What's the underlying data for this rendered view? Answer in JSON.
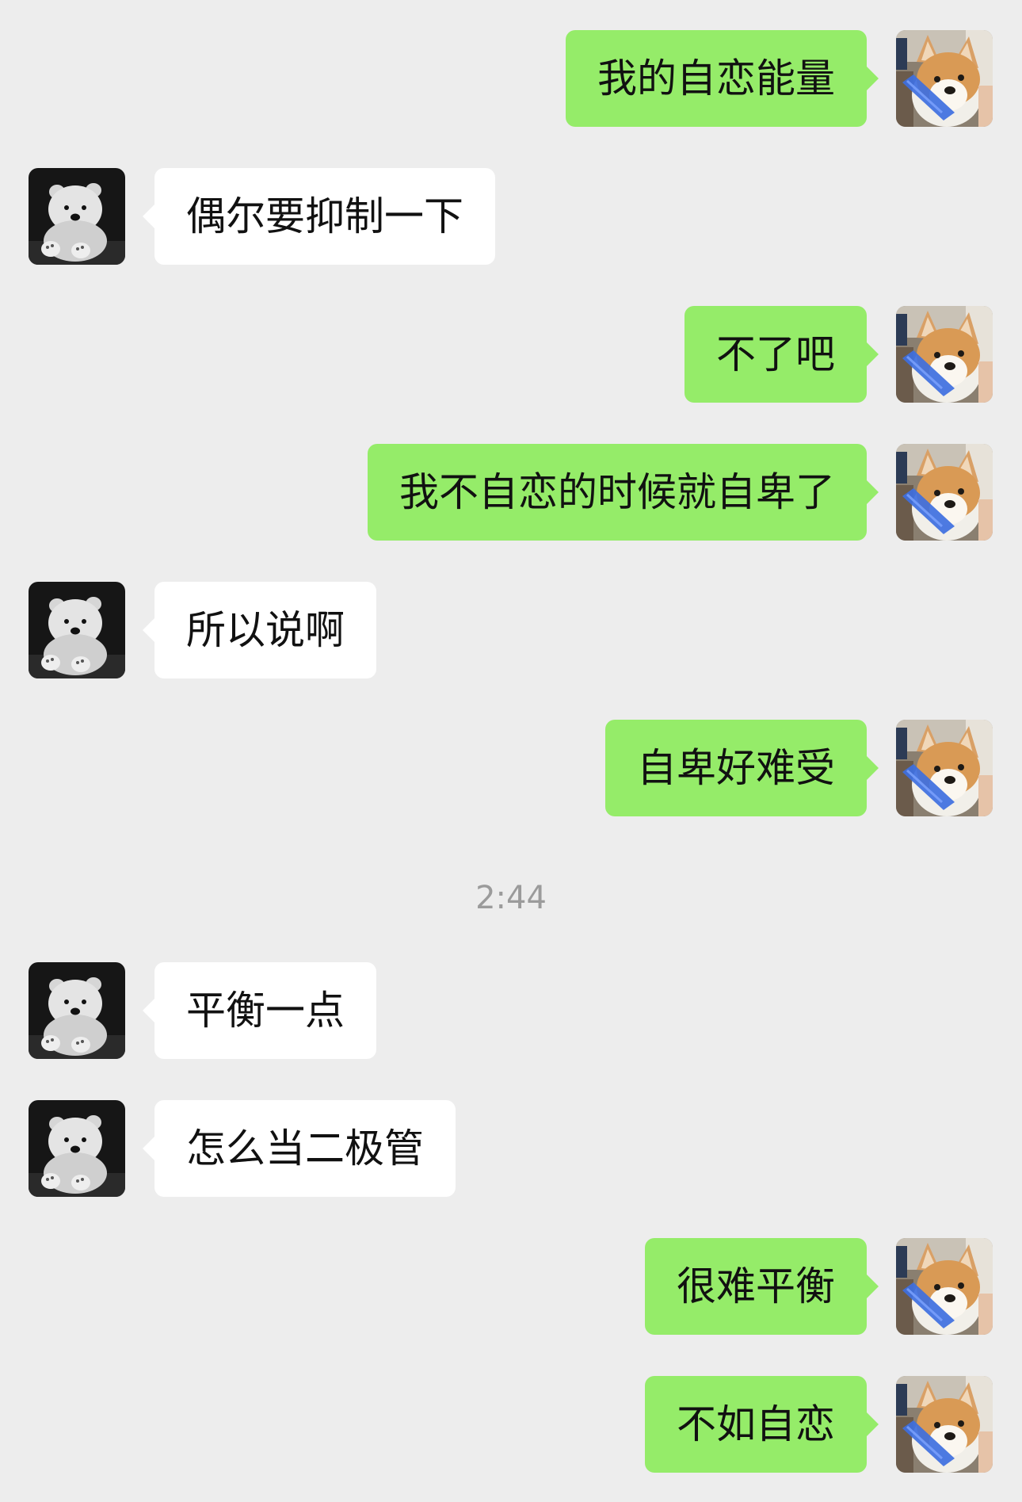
{
  "colors": {
    "background": "#ededed",
    "outgoing_bubble": "#95ec69",
    "incoming_bubble": "#ffffff",
    "message_text": "#111111",
    "timestamp_text": "#9b9b9b"
  },
  "avatars": {
    "self": "shiba-dog-avatar",
    "contact": "white-plush-bear-avatar"
  },
  "messages": [
    {
      "from": "self",
      "text": "我的自恋能量"
    },
    {
      "from": "contact",
      "text": "偶尔要抑制一下"
    },
    {
      "from": "self",
      "text": "不了吧"
    },
    {
      "from": "self",
      "text": "我不自恋的时候就自卑了"
    },
    {
      "from": "contact",
      "text": "所以说啊"
    },
    {
      "from": "self",
      "text": "自卑好难受"
    },
    {
      "from": "contact",
      "text": "平衡一点"
    },
    {
      "from": "contact",
      "text": "怎么当二极管"
    },
    {
      "from": "self",
      "text": "很难平衡"
    },
    {
      "from": "self",
      "text": "不如自恋"
    }
  ],
  "timestamp": "2:44"
}
